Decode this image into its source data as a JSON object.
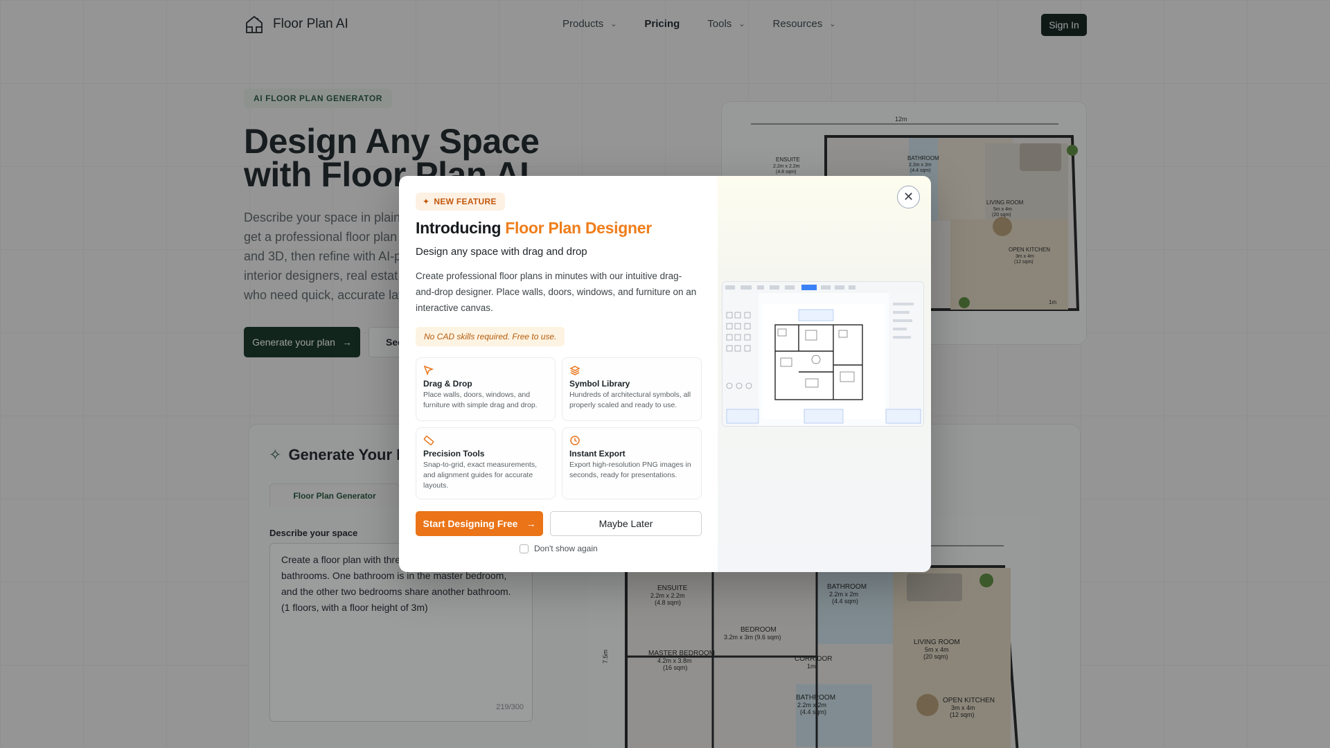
{
  "nav": {
    "logo_text": "Floor Plan AI",
    "links": [
      "Products",
      "Pricing",
      "Tools",
      "Resources"
    ],
    "signin": "Sign In"
  },
  "hero": {
    "badge": "AI FLOOR PLAN GENERATOR",
    "title_line1": "Design Any Space",
    "title_line2": "with Floor Plan AI",
    "desc_lines": [
      "Describe your space in plain",
      "get a professional floor plan",
      "and 3D, then refine with AI-p",
      "interior designers, real estat",
      "who need quick, accurate lay"
    ],
    "cta_primary": "Generate your plan",
    "cta_secondary": "See"
  },
  "plan_labels": {
    "top_dim": "12m",
    "ensuite": "ENSUITE",
    "ensuite_dim": "2.2m x 2.2m",
    "ensuite_sqm": "(4.8 sqm)",
    "bathroom": "BATHROOM",
    "bathroom_dim": "2.2m x 2m",
    "bathroom_sqm": "(4.4 sqm)",
    "living": "LIVING ROOM",
    "living_dim": "5m x 4m",
    "living_sqm": "(20 sqm)",
    "kitchen": "OPEN KITCHEN",
    "kitchen_dim": "3m x 4m",
    "kitchen_sqm": "(12 sqm)",
    "scale": "1m",
    "bedroom": "BEDROOM",
    "bedroom_dim": "3.2m x 3m (9.6 sqm)",
    "master": "MASTER BEDROOM",
    "master_dim": "4.2m x 3.8m",
    "master_sqm": "(16 sqm)",
    "corridor": "CORRIDOR",
    "corridor_dim": "1m",
    "side_dim": "7.5m"
  },
  "generator": {
    "title": "Generate Your Fl",
    "tab": "Floor Plan Generator",
    "label": "Describe your space",
    "text": "Create a floor plan with thre an open kitchen, and two bathrooms. One bathroom is in the master bedroom, and the other two bedrooms share another bathroom. (1 floors, with a floor height of 3m)",
    "counter": "219/300"
  },
  "modal": {
    "badge": "NEW FEATURE",
    "title_prefix": "Introducing ",
    "title_accent": "Floor Plan Designer",
    "subtitle": "Design any space with drag and drop",
    "description": "Create professional floor plans in minutes with our intuitive drag-and-drop designer. Place walls, doors, windows, and furniture on an interactive canvas.",
    "note": "No CAD skills required. Free to use.",
    "features": [
      {
        "icon": "cursor-icon",
        "title": "Drag & Drop",
        "text": "Place walls, doors, windows, and furniture with simple drag and drop."
      },
      {
        "icon": "layers-icon",
        "title": "Symbol Library",
        "text": "Hundreds of architectural symbols, all properly scaled and ready to use."
      },
      {
        "icon": "ruler-icon",
        "title": "Precision Tools",
        "text": "Snap-to-grid, exact measurements, and alignment guides for accurate layouts."
      },
      {
        "icon": "clock-icon",
        "title": "Instant Export",
        "text": "Export high-resolution PNG images in seconds, ready for presentations."
      }
    ],
    "start_button": "Start Designing Free",
    "later_button": "Maybe Later",
    "dont_show": "Don't show again"
  },
  "colors": {
    "accent_orange": "#ea7417",
    "brand_green": "#103120",
    "overlay": "rgba(20,22,24,0.42)"
  }
}
